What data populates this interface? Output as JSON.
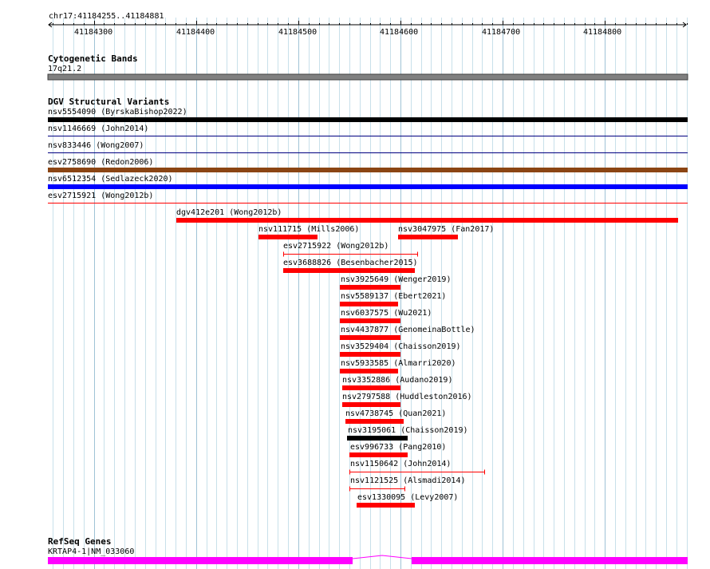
{
  "region": {
    "label": "chr17:41184255..41184881",
    "start": 41184255,
    "end": 41184881
  },
  "ruler": {
    "ticks": [
      "41184300",
      "41184400",
      "41184500",
      "41184600",
      "41184700",
      "41184800"
    ]
  },
  "tracks": {
    "cytobands": {
      "title": "Cytogenetic Bands",
      "band": {
        "name": "17q21.2",
        "color": "#808080"
      }
    },
    "dgv": {
      "title": "DGV Structural Variants",
      "variants": [
        {
          "label": "nsv5554090 (ByrskaBishop2022)",
          "start": 41184255,
          "end": 41184881,
          "color": "#000000",
          "style": "full-bar"
        },
        {
          "label": "nsv1146669 (John2014)",
          "start": 41184255,
          "end": 41184881,
          "color": "#000080",
          "style": "full-line"
        },
        {
          "label": "nsv833446 (Wong2007)",
          "start": 41184255,
          "end": 41184881,
          "color": "#000080",
          "style": "full-line"
        },
        {
          "label": "esv2758690 (Redon2006)",
          "start": 41184255,
          "end": 41184881,
          "color": "#8b4513",
          "style": "full-bar"
        },
        {
          "label": "nsv6512354 (Sedlazeck2020)",
          "start": 41184255,
          "end": 41184881,
          "color": "#0000ff",
          "style": "full-bar"
        },
        {
          "label": "esv2715921 (Wong2012b)",
          "start": 41184255,
          "end": 41184881,
          "color": "#ff0000",
          "style": "full-line"
        },
        {
          "label": "dgv412e201 (Wong2012b)",
          "start": 41184381,
          "end": 41184872,
          "color": "#ff0000",
          "style": "bar"
        },
        {
          "label": "nsv111715 (Mills2006)",
          "start": 41184461,
          "end": 41184519,
          "color": "#ff0000",
          "style": "bar"
        },
        {
          "label": "nsv3047975 (Fan2017)",
          "start": 41184598,
          "end": 41184656,
          "color": "#ff0000",
          "style": "bar"
        },
        {
          "label": "esv2715922 (Wong2012b)",
          "start": 41184485,
          "end": 41184617,
          "color": "#ff0000",
          "style": "line"
        },
        {
          "label": "esv3688826 (Besenbacher2015)",
          "start": 41184485,
          "end": 41184614,
          "color": "#ff0000",
          "style": "bar"
        },
        {
          "label": "nsv3925649 (Wenger2019)",
          "start": 41184541,
          "end": 41184600,
          "color": "#ff0000",
          "style": "bar"
        },
        {
          "label": "nsv5589137 (Ebert2021)",
          "start": 41184541,
          "end": 41184598,
          "color": "#ff0000",
          "style": "bar"
        },
        {
          "label": "nsv6037575 (Wu2021)",
          "start": 41184541,
          "end": 41184600,
          "color": "#ff0000",
          "style": "bar"
        },
        {
          "label": "nsv4437877 (GenomeinaBottle)",
          "start": 41184541,
          "end": 41184600,
          "color": "#ff0000",
          "style": "bar"
        },
        {
          "label": "nsv3529404 (Chaisson2019)",
          "start": 41184541,
          "end": 41184600,
          "color": "#ff0000",
          "style": "bar"
        },
        {
          "label": "nsv5933585 (Almarri2020)",
          "start": 41184541,
          "end": 41184598,
          "color": "#ff0000",
          "style": "bar"
        },
        {
          "label": "nsv3352886 (Audano2019)",
          "start": 41184543,
          "end": 41184600,
          "color": "#ff0000",
          "style": "bar"
        },
        {
          "label": "nsv2797588 (Huddleston2016)",
          "start": 41184543,
          "end": 41184600,
          "color": "#ff0000",
          "style": "bar"
        },
        {
          "label": "nsv4738745 (Quan2021)",
          "start": 41184546,
          "end": 41184603,
          "color": "#ff0000",
          "style": "bar"
        },
        {
          "label": "nsv3195061 (Chaisson2019)",
          "start": 41184548,
          "end": 41184607,
          "color": "#000000",
          "style": "bar"
        },
        {
          "label": "esv996733 (Pang2010)",
          "start": 41184550,
          "end": 41184607,
          "color": "#ff0000",
          "style": "bar"
        },
        {
          "label": "nsv1150642 (John2014)",
          "start": 41184550,
          "end": 41184683,
          "color": "#ff0000",
          "style": "line"
        },
        {
          "label": "nsv1121525 (Alsmadi2014)",
          "start": 41184550,
          "end": 41184605,
          "color": "#ff0000",
          "style": "line"
        },
        {
          "label": "esv1330095 (Levy2007)",
          "start": 41184557,
          "end": 41184614,
          "color": "#ff0000",
          "style": "bar"
        }
      ]
    },
    "refseq": {
      "title": "RefSeq Genes",
      "gene": {
        "label": "KRTAP4-1|NM_033060",
        "color": "#ff00ff",
        "exons": [
          [
            41184255,
            41184553
          ],
          [
            41184611,
            41184881
          ]
        ]
      }
    }
  }
}
